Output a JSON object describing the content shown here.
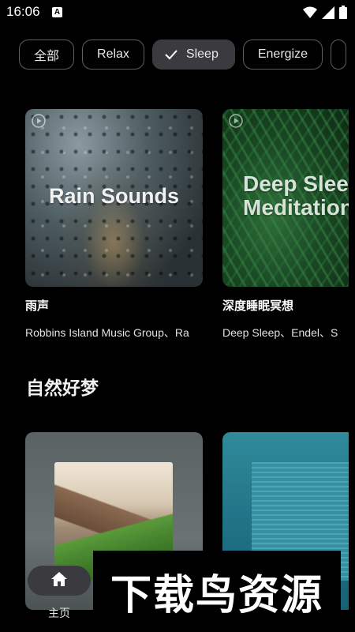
{
  "status_bar": {
    "time": "16:06",
    "notification_letter": "A",
    "icons": [
      "wifi-icon",
      "signal-icon",
      "battery-icon"
    ]
  },
  "chips": [
    {
      "label": "全部",
      "selected": false
    },
    {
      "label": "Relax",
      "selected": false
    },
    {
      "label": "Sleep",
      "selected": true
    },
    {
      "label": "Energize",
      "selected": false
    }
  ],
  "featured": [
    {
      "cover_text": "Rain Sounds",
      "title": "雨声",
      "artists": "Robbins Island Music Group、Ra"
    },
    {
      "cover_text": "Deep Sleep Meditation",
      "title": "深度睡眠冥想",
      "artists": "Deep Sleep、Endel、S"
    }
  ],
  "section": {
    "title": "自然好梦"
  },
  "bottom_nav": {
    "home_label": "主页",
    "home_icon": "home-icon"
  },
  "watermark": "下载鸟资源",
  "colors": {
    "background": "#000000",
    "chip_selected": "#3a3a3f",
    "chip_border": "#5d5d62"
  }
}
